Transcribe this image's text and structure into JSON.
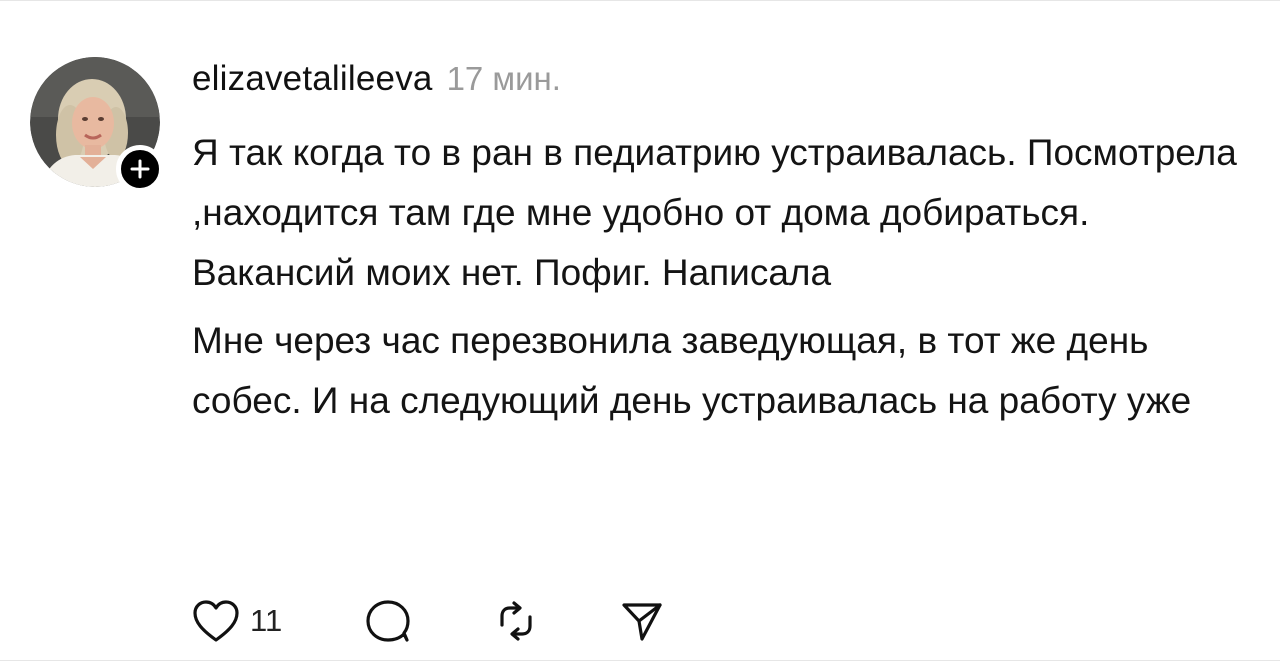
{
  "post": {
    "username": "elizavetalileeva",
    "time": "17 мин.",
    "paragraphs": [
      "Я так когда то в ран в педиатрию устраивалась. Посмотрела ,находится там где мне удобно от дома добираться. Вакансий моих нет. Пофиг. Написала",
      "Мне через час перезвонила заведующая, в тот же день собес. И на следующий день устраивалась на работу уже"
    ],
    "likes": "11"
  },
  "icons": {
    "avatar": "avatar",
    "follow": "plus-icon",
    "like": "heart-icon",
    "reply": "comment-icon",
    "repost": "repost-icon",
    "share": "send-icon"
  },
  "colors": {
    "text": "#111111",
    "meta": "#9a9a9a",
    "badge": "#000000"
  }
}
